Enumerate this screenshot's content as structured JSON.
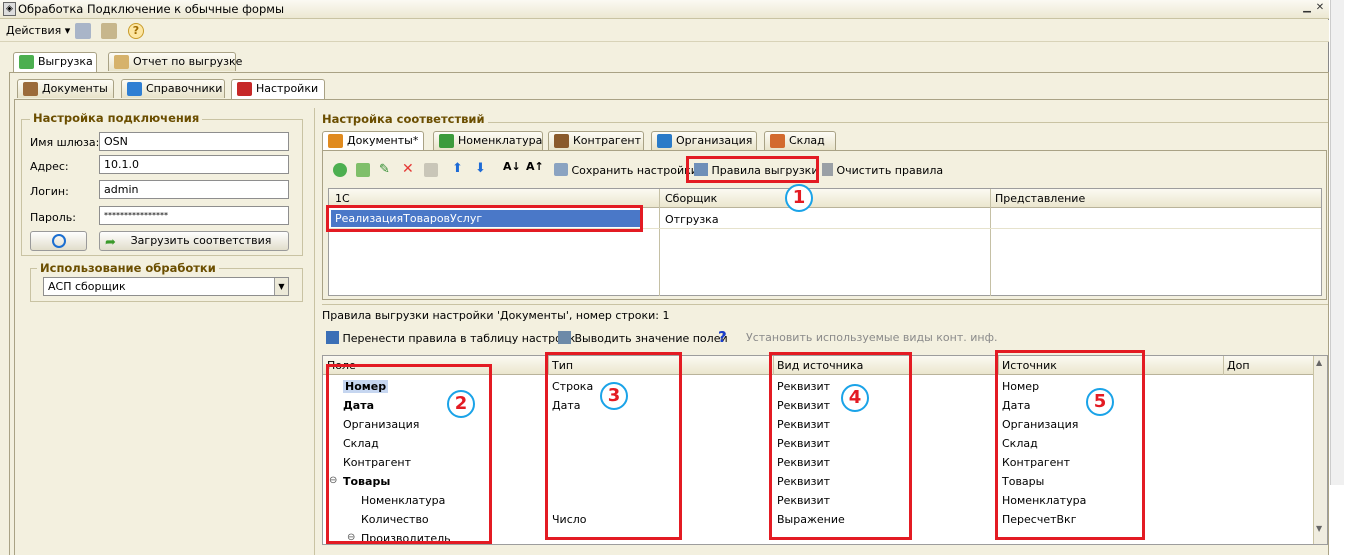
{
  "window": {
    "title": "Обработка  Подключение к обычные формы"
  },
  "toolbar": {
    "actions_label": "Действия"
  },
  "main_tabs": [
    {
      "label": "Выгрузка"
    },
    {
      "label": "Отчет по выгрузке"
    }
  ],
  "sub_tabs": [
    {
      "label": "Документы"
    },
    {
      "label": "Справочники"
    },
    {
      "label": "Настройки"
    }
  ],
  "connection": {
    "title": "Настройка подключения",
    "gateway_label": "Имя шлюза:",
    "gateway_value": "OSN",
    "address_label": "Адрес:",
    "address_value": "10.1.0",
    "login_label": "Логин:",
    "login_value": "admin",
    "password_label": "Пароль:",
    "password_value": "****************",
    "load_button": "Загрузить соответствия"
  },
  "usage": {
    "title": "Использование обработки",
    "selected": "АСП сборщик"
  },
  "mapping": {
    "title": "Настройка соответствий",
    "tabs": [
      {
        "label": "Документы*"
      },
      {
        "label": "Номенклатура"
      },
      {
        "label": "Контрагент"
      },
      {
        "label": "Организация"
      },
      {
        "label": "Склад"
      }
    ],
    "save_settings": "Сохранить настройки",
    "export_rules": "Правила выгрузки",
    "clear_rules": "Очистить правила",
    "columns": [
      "1С",
      "Сборщик",
      "Представление"
    ],
    "rows": [
      {
        "c1": "РеализацияТоваровУслуг",
        "c2": "Отгрузка",
        "c3": ""
      }
    ]
  },
  "rules": {
    "caption": "Правила выгрузки настройки 'Документы', номер строки: 1",
    "transfer_button": "Перенести правила в таблицу настроек",
    "show_values_button": "Выводить значение полей",
    "set_contact_types": "Установить используемые виды конт. инф.",
    "columns": [
      "Поле",
      "Тип",
      "Вид источника",
      "Источник",
      "Доп"
    ],
    "rows": [
      {
        "field": "Номер",
        "type": "Строка",
        "kind": "Реквизит",
        "source": "Номер"
      },
      {
        "field": "Дата",
        "type": "Дата",
        "kind": "Реквизит",
        "source": "Дата"
      },
      {
        "field": "Организация",
        "type": "",
        "kind": "Реквизит",
        "source": "Организация"
      },
      {
        "field": "Склад",
        "type": "",
        "kind": "Реквизит",
        "source": "Склад"
      },
      {
        "field": "Контрагент",
        "type": "",
        "kind": "Реквизит",
        "source": "Контрагент"
      },
      {
        "field": "Товары",
        "type": "",
        "kind": "Реквизит",
        "source": "Товары"
      },
      {
        "field": "Номенклатура",
        "type": "",
        "kind": "Реквизит",
        "source": "Номенклатура"
      },
      {
        "field": "Количество",
        "type": "Число",
        "kind": "Выражение",
        "source": "ПересчетВкг"
      },
      {
        "field": "Производитель",
        "type": "",
        "kind": "",
        "source": ""
      }
    ]
  },
  "annotations": [
    "1",
    "2",
    "3",
    "4",
    "5"
  ],
  "colors": {
    "highlight_red": "#e31b23",
    "circle_blue": "#1aa3e8",
    "selection": "#4a78c8"
  }
}
